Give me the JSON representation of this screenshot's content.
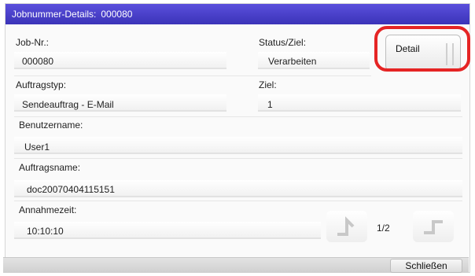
{
  "window": {
    "title": "Jobnummer-Details:",
    "job_number": "000080"
  },
  "fields": {
    "job_nr": {
      "label": "Job-Nr.:",
      "value": "000080"
    },
    "status_ziel": {
      "label": "Status/Ziel:",
      "value": "Verarbeiten"
    },
    "auftragstyp": {
      "label": "Auftragstyp:",
      "value": "Sendeauftrag - E-Mail"
    },
    "ziel": {
      "label": "Ziel:",
      "value": "1"
    },
    "benutzername": {
      "label": "Benutzername:",
      "value": "User1"
    },
    "auftragsname": {
      "label": "Auftragsname:",
      "value": "doc20070404115151"
    },
    "annahmezeit": {
      "label": "Annahmezeit:",
      "value": "10:10:10"
    }
  },
  "buttons": {
    "detail": "Detail",
    "close": "Schließen"
  },
  "pager": {
    "text": "1/2"
  },
  "colors": {
    "title_bar": "#4a41c9",
    "highlight": "#e52424"
  }
}
